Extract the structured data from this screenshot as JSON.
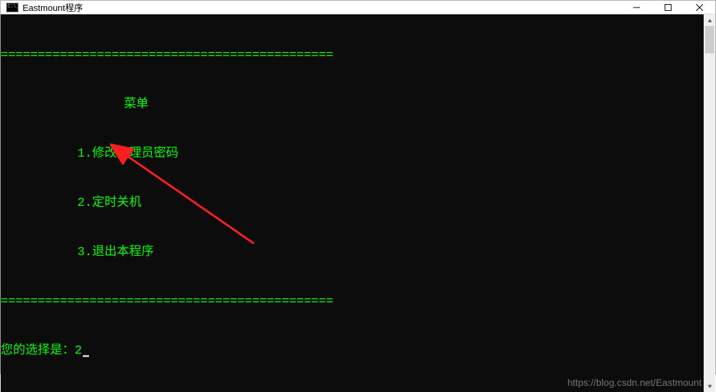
{
  "window": {
    "title": "Eastmount程序"
  },
  "console": {
    "divider": "=============================================",
    "menu_title": "菜单",
    "items": [
      "1.修改管理员密码",
      "2.定时关机",
      "3.退出本程序"
    ],
    "prompt_label": "您的选择是：",
    "input_value": "2"
  },
  "watermark": "https://blog.csdn.net/Eastmount"
}
